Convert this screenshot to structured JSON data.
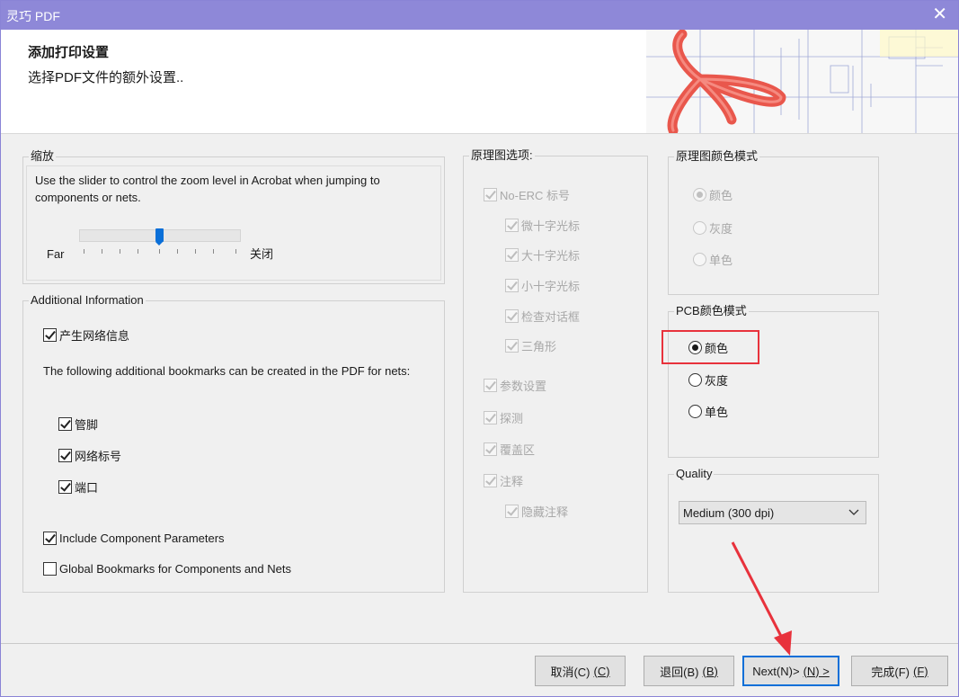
{
  "window": {
    "title": "灵巧 PDF",
    "close_glyph": "✕"
  },
  "header": {
    "title": "添加打印设置",
    "subtitle": "选择PDF文件的额外设置.."
  },
  "zoom": {
    "label": "缩放",
    "description": "Use the slider to control the zoom level in Acrobat when jumping to components or nets.",
    "left_label": "Far",
    "right_label": "关闭",
    "level": 0.5
  },
  "additional": {
    "label": "Additional Information",
    "generate_net_info": "产生网络信息",
    "bookmarks_text": "The following additional bookmarks can be created in the PDF for nets:",
    "pins": "管脚",
    "net_labels": "网络标号",
    "ports": "端口",
    "include_component_params": "Include Component Parameters",
    "global_bookmarks": "Global Bookmarks for Components and Nets"
  },
  "schematic_options": {
    "label": "原理图选项:",
    "no_erc": "No-ERC 标号",
    "small_cross_cursor": "微十字光标",
    "large_cross_cursor": "大十字光标",
    "tiny_cross_cursor": "小十字光标",
    "check_dialog": "检查对话框",
    "triangle": "三角形",
    "param_settings": "参数设置",
    "probes": "探测",
    "covered_area": "覆盖区",
    "notes": "注释",
    "hidden_notes": "隐藏注释"
  },
  "schematic_color": {
    "label": "原理图颜色模式",
    "color": "颜色",
    "gray": "灰度",
    "mono": "单色"
  },
  "pcb_color": {
    "label": "PCB颜色模式",
    "color": "颜色",
    "gray": "灰度",
    "mono": "单色"
  },
  "quality": {
    "label": "Quality",
    "selected": "Medium (300 dpi)"
  },
  "buttons": {
    "cancel": "取消(C)",
    "cancel_key": "(C)",
    "back": "退回(B)",
    "back_key": "(B)",
    "next": "Next(N)>",
    "next_key": "(N) >",
    "finish": "完成(F)",
    "finish_key": "(F)"
  },
  "colors": {
    "titlebar": "#8e88d8",
    "accent": "#0a6fd8",
    "annotation": "#e8323c"
  }
}
